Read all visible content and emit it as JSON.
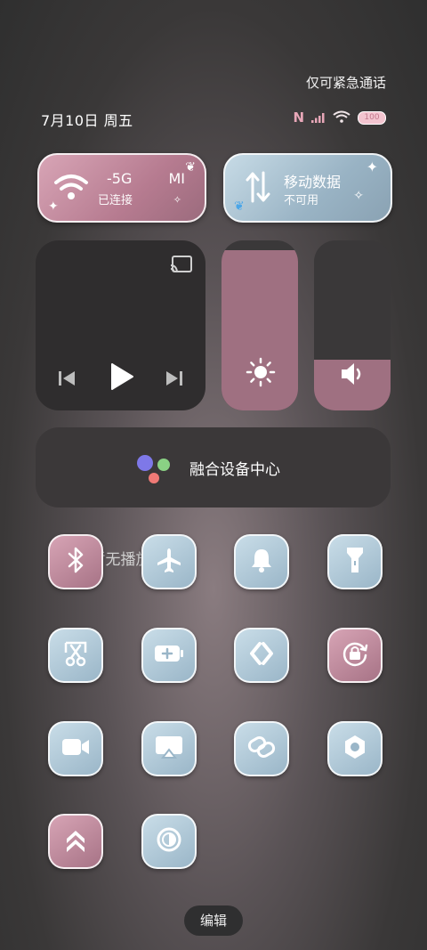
{
  "status_bar": {
    "emergency_text": "仅可紧急通话",
    "date_text": "7月10日 周五",
    "nfc_glyph": "N",
    "battery_text": "100"
  },
  "wifi_tile": {
    "title": "-5G",
    "suffix": "MI",
    "status": "已连接",
    "state": "on",
    "color": "#b67b90"
  },
  "data_tile": {
    "title": "移动数据",
    "status": "不可用",
    "state": "off",
    "color": "#99b3c4"
  },
  "media": {
    "label": "暂无播放"
  },
  "sliders": {
    "brightness_level": 0.94,
    "volume_level": 0.3
  },
  "device_center": {
    "label": "融合设备中心"
  },
  "edit": {
    "label": "编辑"
  },
  "toggles": [
    {
      "name": "bluetooth",
      "state": "on"
    },
    {
      "name": "airplane-mode",
      "state": "off"
    },
    {
      "name": "silent-mode",
      "state": "off"
    },
    {
      "name": "flashlight",
      "state": "off"
    },
    {
      "name": "screenshot",
      "state": "off"
    },
    {
      "name": "battery-saver",
      "state": "off"
    },
    {
      "name": "app-link",
      "state": "off"
    },
    {
      "name": "rotation-lock",
      "state": "on"
    },
    {
      "name": "screen-recorder",
      "state": "off"
    },
    {
      "name": "cast",
      "state": "off"
    },
    {
      "name": "link",
      "state": "off"
    },
    {
      "name": "camera-settings",
      "state": "off"
    },
    {
      "name": "performance-mode",
      "state": "on"
    },
    {
      "name": "dark-mode",
      "state": "off"
    }
  ]
}
